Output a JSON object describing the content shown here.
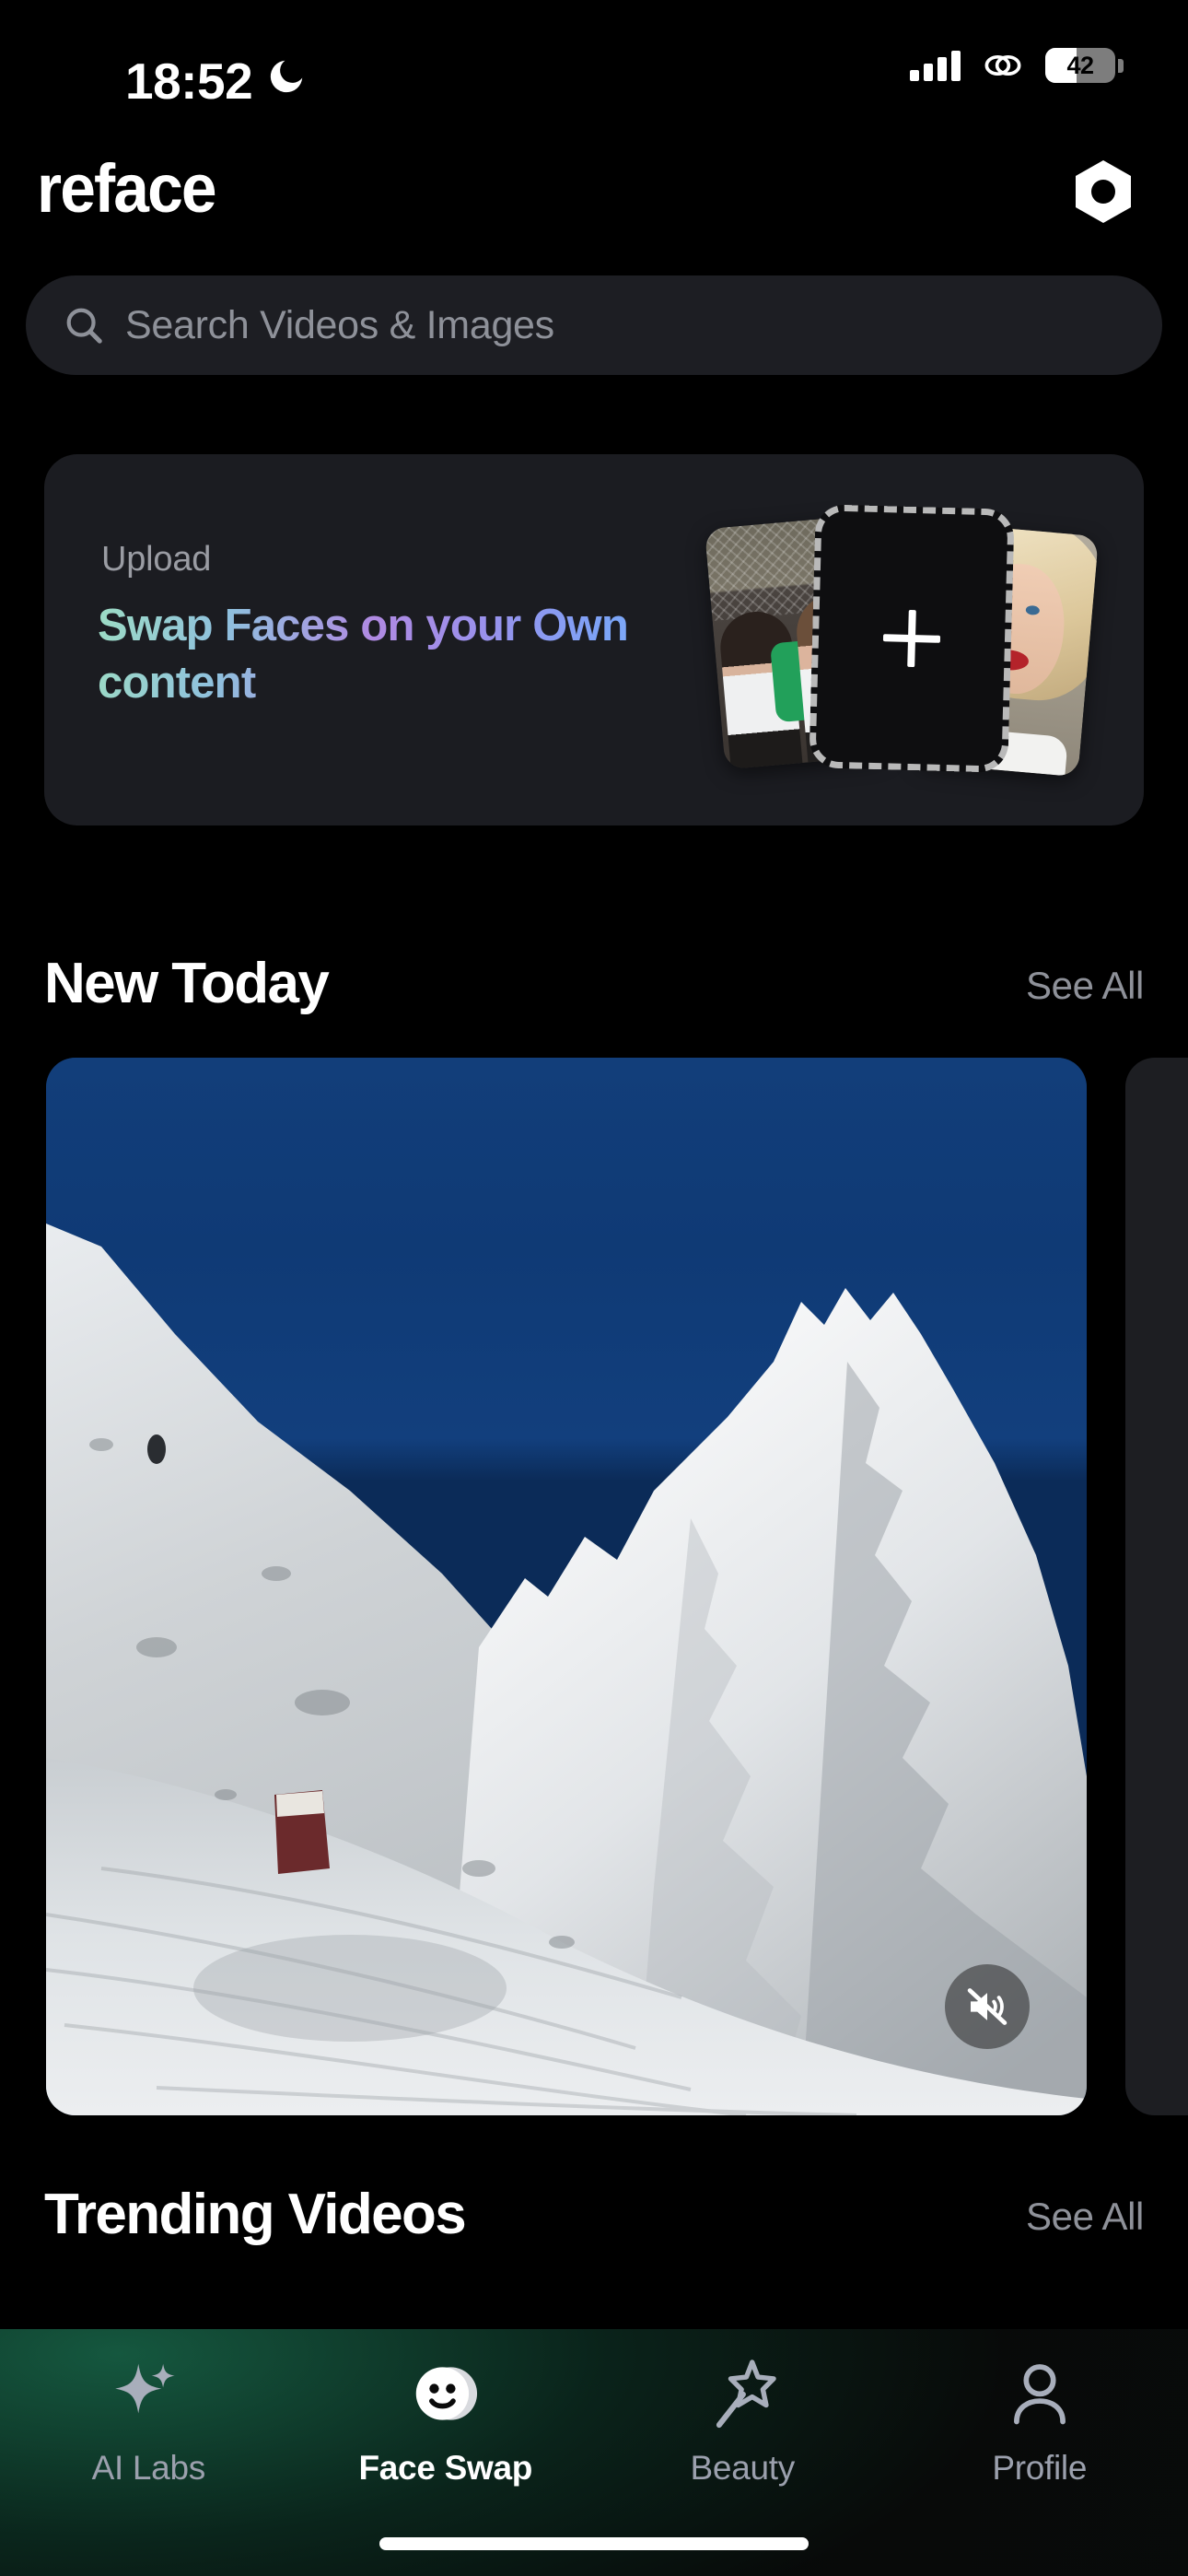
{
  "status_bar": {
    "time": "18:52",
    "dnd_icon": "crescent-moon-icon",
    "signal_icon": "cellular-signal-icon",
    "link_icon": "chain-link-icon",
    "battery_level": "42",
    "battery_fill_percent": 45
  },
  "header": {
    "app_name": "reface",
    "account_icon": "hexagon-nut-icon"
  },
  "search": {
    "placeholder": "Search Videos & Images",
    "value": "",
    "icon": "search-icon"
  },
  "upload_card": {
    "label": "Upload",
    "title": "Swap Faces on your Own content",
    "plus_icon": "plus-icon",
    "gradient": {
      "from": "#9ddcc4",
      "mid": "#b08ae2",
      "to": "#7ba4f7"
    },
    "thumbnails": [
      {
        "name": "two-women-photo"
      },
      {
        "name": "blonde-woman-photo"
      }
    ]
  },
  "sections": [
    {
      "title": "New Today",
      "see_all": "See All"
    },
    {
      "title": "Trending Videos",
      "see_all": "See All"
    }
  ],
  "new_today": {
    "card": {
      "name": "snow-mountain-video",
      "mute_icon": "speaker-muted-icon",
      "muted": true
    }
  },
  "trending": {
    "cards": [
      {
        "name": "trending-card-green",
        "color": "#2fe0a0"
      },
      {
        "name": "trending-card-red",
        "color": "#8a1c22"
      },
      {
        "name": "trending-card-tan",
        "color": "#cdb088"
      }
    ]
  },
  "tab_bar": {
    "active": "Face Swap",
    "items": [
      {
        "label": "AI Labs",
        "icon": "sparkles-icon",
        "active": false
      },
      {
        "label": "Face Swap",
        "icon": "smiley-face-swap-icon",
        "active": true
      },
      {
        "label": "Beauty",
        "icon": "magic-wand-star-icon",
        "active": false
      },
      {
        "label": "Profile",
        "icon": "person-icon",
        "active": false
      }
    ]
  },
  "colors": {
    "background": "#000000",
    "card": "#1b1c21",
    "search_field": "#1d1e23",
    "muted_text": "#8e9199",
    "accent_green": "#2fe0a0"
  }
}
